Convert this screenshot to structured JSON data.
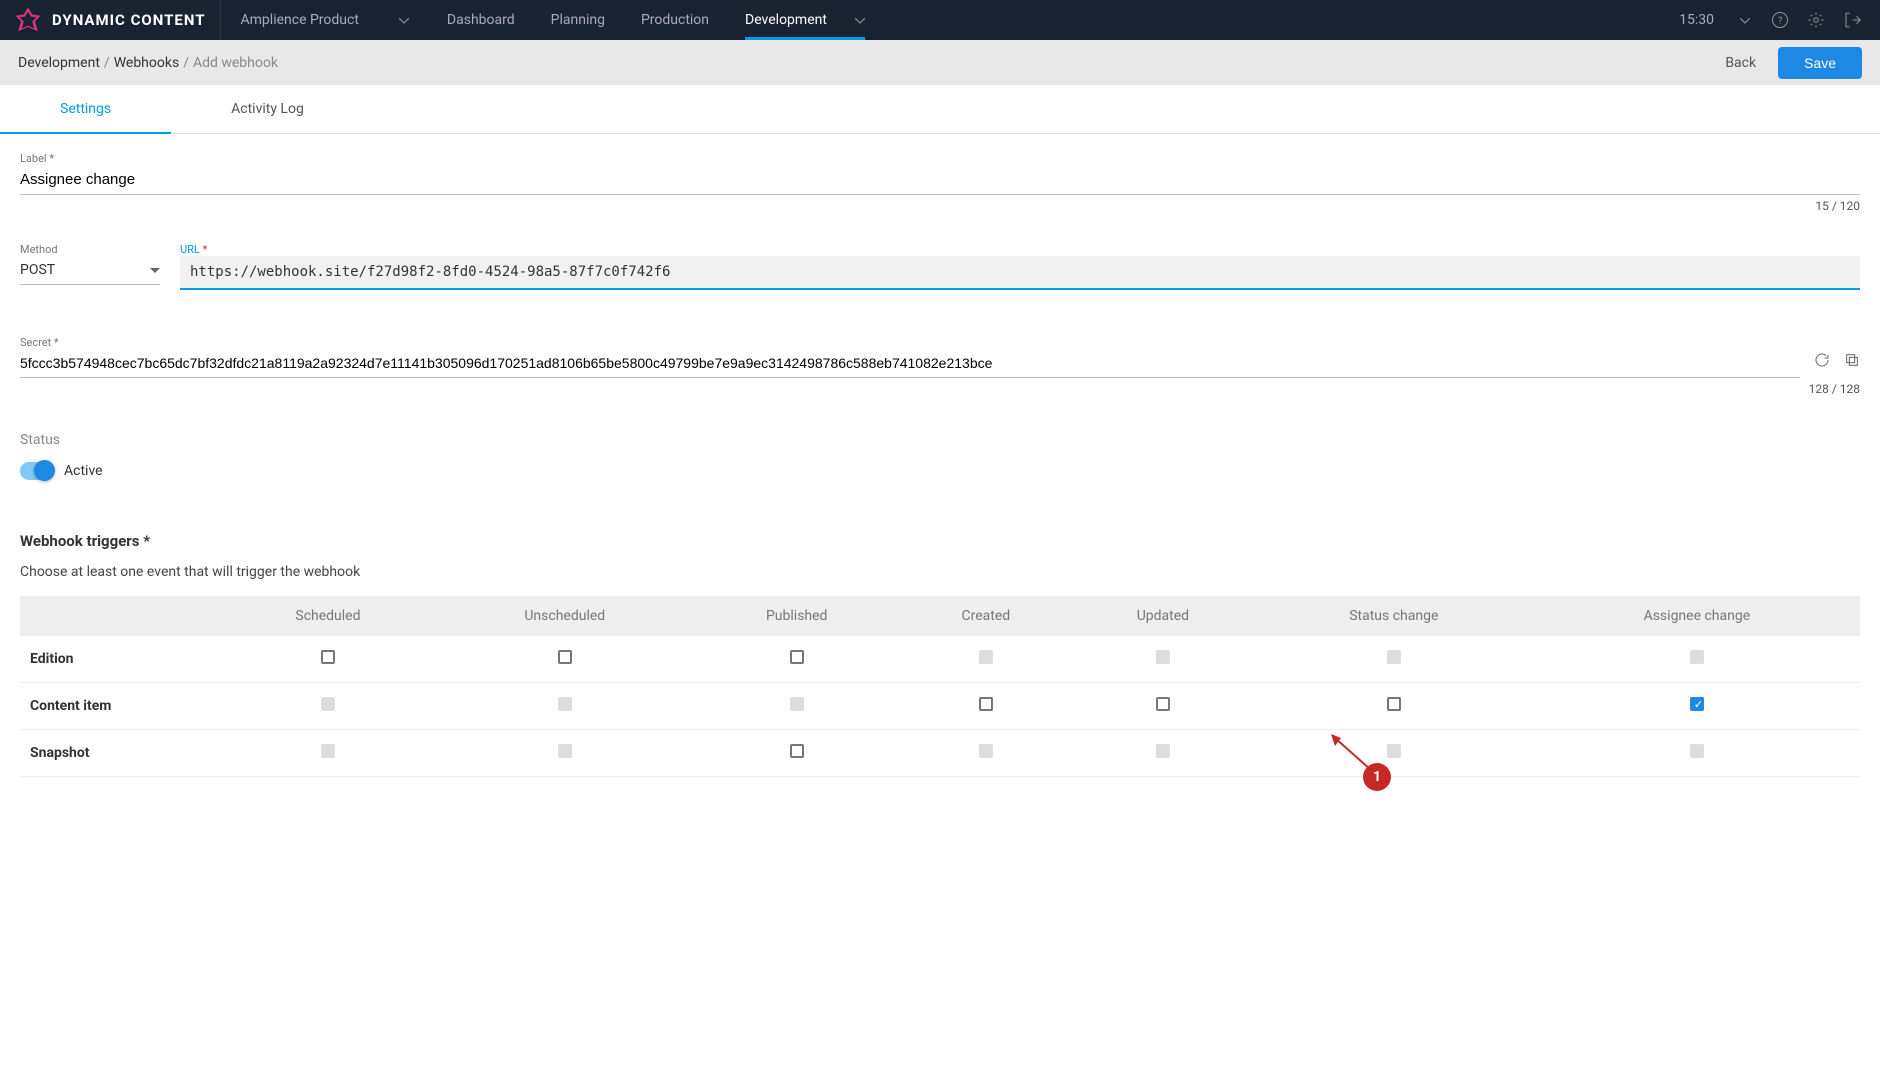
{
  "brand": "DYNAMIC CONTENT",
  "hub": "Amplience Product",
  "nav": {
    "dashboard": "Dashboard",
    "planning": "Planning",
    "production": "Production",
    "development": "Development"
  },
  "time": "15:30",
  "breadcrumb": {
    "root": "Development",
    "mid": "Webhooks",
    "leaf": "Add webhook"
  },
  "actions": {
    "back": "Back",
    "save": "Save"
  },
  "tabs": {
    "settings": "Settings",
    "activity": "Activity Log"
  },
  "form": {
    "label_label": "Label",
    "label_value": "Assignee change",
    "label_counter": "15 / 120",
    "method_label": "Method",
    "method_value": "POST",
    "url_label": "URL",
    "url_value": "https://webhook.site/f27d98f2-8fd0-4524-98a5-87f7c0f742f6",
    "secret_label": "Secret",
    "secret_value": "5fccc3b574948cec7bc65dc7bf32dfdc21a8119a2a92324d7e11141b305096d170251ad8106b65be5800c49799be7e9a9ec3142498786c588eb741082e213bce",
    "secret_counter": "128 / 128",
    "status_label": "Status",
    "status_value": "Active",
    "triggers_title": "Webhook triggers *",
    "triggers_desc": "Choose at least one event that will trigger the webhook"
  },
  "triggers": {
    "headers": [
      "",
      "Scheduled",
      "Unscheduled",
      "Published",
      "Created",
      "Updated",
      "Status change",
      "Assignee change"
    ],
    "rows": [
      {
        "name": "Edition",
        "cells": [
          "enabled",
          "enabled",
          "enabled",
          "disabled",
          "disabled",
          "disabled",
          "disabled"
        ]
      },
      {
        "name": "Content item",
        "cells": [
          "disabled",
          "disabled",
          "disabled",
          "enabled",
          "enabled",
          "enabled",
          "checked"
        ]
      },
      {
        "name": "Snapshot",
        "cells": [
          "disabled",
          "disabled",
          "enabled",
          "disabled",
          "disabled",
          "disabled",
          "disabled"
        ]
      }
    ]
  },
  "annotation": "1"
}
